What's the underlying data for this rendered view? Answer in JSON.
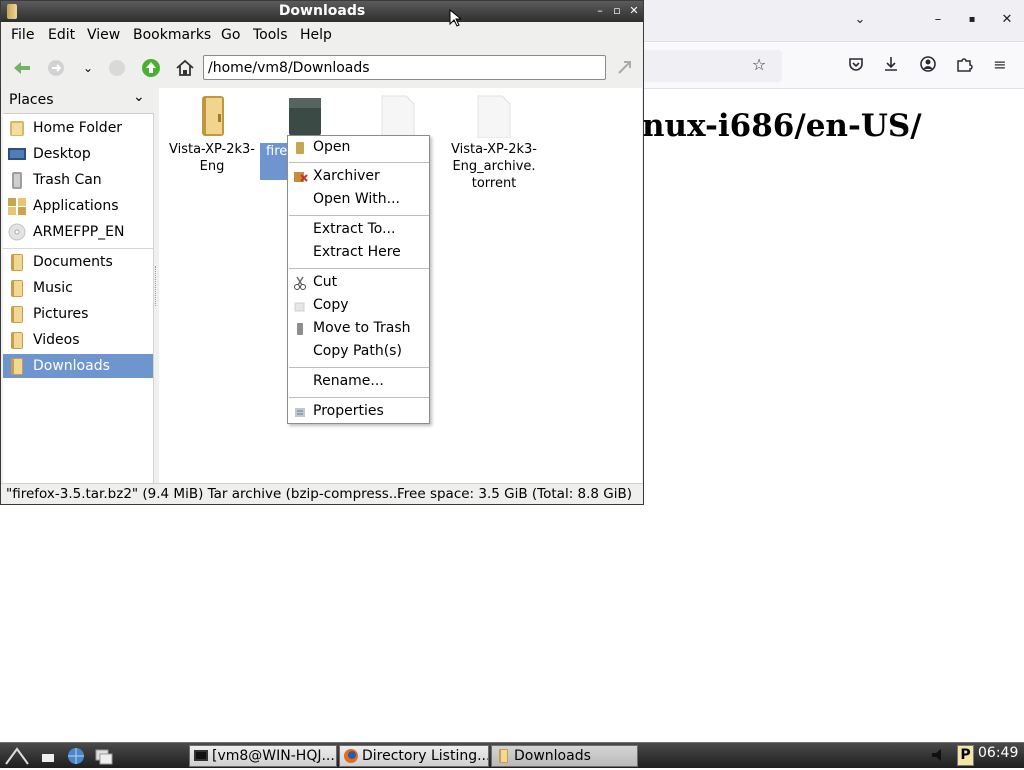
{
  "browser": {
    "heading": "nux-i686/en-US/",
    "controls": {
      "chevron": "⌄",
      "minimize": "–",
      "maximize": "▪",
      "close": "✕"
    },
    "toolbar_icons": [
      "star-icon",
      "pocket-icon",
      "download-icon",
      "account-icon",
      "extensions-icon",
      "menu-icon"
    ]
  },
  "fm": {
    "title": "Downloads",
    "window_buttons": {
      "minimize": "–",
      "maximize": "▫",
      "close": "✕"
    },
    "menu": [
      "File",
      "Edit",
      "View",
      "Bookmarks",
      "Go",
      "Tools",
      "Help"
    ],
    "path": "/home/vm8/Downloads",
    "places_label": "Places",
    "places": [
      {
        "label": "Home Folder",
        "icon": "home-folder-icon"
      },
      {
        "label": "Desktop",
        "icon": "desktop-icon"
      },
      {
        "label": "Trash Can",
        "icon": "trash-icon"
      },
      {
        "label": "Applications",
        "icon": "applications-icon"
      },
      {
        "label": "ARMEFPP_EN",
        "icon": "disc-icon"
      }
    ],
    "bookmarks": [
      {
        "label": "Documents",
        "icon": "folder-icon"
      },
      {
        "label": "Music",
        "icon": "folder-icon"
      },
      {
        "label": "Pictures",
        "icon": "folder-icon"
      },
      {
        "label": "Videos",
        "icon": "folder-icon"
      },
      {
        "label": "Downloads",
        "icon": "folder-icon",
        "selected": true
      }
    ],
    "files": [
      {
        "name": "Vista-XP-2k3-\nEng",
        "icon": "folder-icon"
      },
      {
        "name": "fire",
        "icon": "archive-icon",
        "selected": true
      },
      {
        "name": "",
        "icon": "file-icon"
      },
      {
        "name": "Vista-XP-2k3-\nEng_archive.\ntorrent",
        "icon": "file-icon"
      }
    ],
    "status_left": "\"firefox-3.5.tar.bz2\" (9.4 MiB) Tar archive (bzip-compress...",
    "status_right": "Free space: 3.5 GiB (Total: 8.8 GiB)"
  },
  "context_menu": {
    "items": [
      {
        "label": "Open",
        "icon": "open-icon"
      },
      {
        "label": "Xarchiver",
        "icon": "xarchiver-icon"
      },
      {
        "label": "Open With...",
        "icon": ""
      },
      {
        "label": "Extract To...",
        "icon": ""
      },
      {
        "label": "Extract Here",
        "icon": ""
      },
      {
        "label": "Cut",
        "icon": "cut-icon"
      },
      {
        "label": "Copy",
        "icon": "copy-icon"
      },
      {
        "label": "Move to Trash",
        "icon": "trash-icon"
      },
      {
        "label": "Copy Path(s)",
        "icon": ""
      },
      {
        "label": "Rename...",
        "icon": ""
      },
      {
        "label": "Properties",
        "icon": "properties-icon"
      }
    ]
  },
  "taskbar": {
    "tasks": [
      {
        "label": "[vm8@WIN-HQJ...",
        "icon": "terminal-icon"
      },
      {
        "label": "Directory Listing...",
        "icon": "firefox-icon"
      },
      {
        "label": "Downloads",
        "icon": "folder-icon",
        "active": true
      }
    ],
    "clock": "06:49",
    "tray_label": "P"
  },
  "colors": {
    "selection": "#6f95cf",
    "titlebar": "#3a3a3a",
    "taskbar": "#2a2a2a"
  }
}
